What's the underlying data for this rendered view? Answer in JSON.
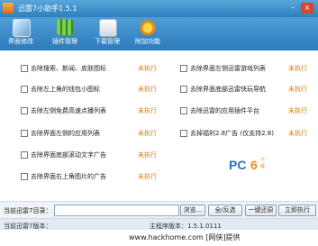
{
  "window": {
    "title": "迅雷7小助手1.5.1",
    "minimize_glyph": "–",
    "close_glyph": "×"
  },
  "toolbar": {
    "items": [
      {
        "label": "界面修改",
        "icon": "window-icon"
      },
      {
        "label": "插件管理",
        "icon": "plugin-bars-icon"
      },
      {
        "label": "下载管理",
        "icon": "download-icon"
      },
      {
        "label": "附加功能",
        "icon": "extra-features-icon"
      }
    ]
  },
  "options": {
    "left": [
      {
        "label": "去除搜索、新闻、皮肤图标",
        "status": "未执行"
      },
      {
        "label": "去除左上角的钱包小图标",
        "status": "未执行"
      },
      {
        "label": "去除左侧免费高速点播列表",
        "status": "未执行"
      },
      {
        "label": "去除界面左侧的应用列表",
        "status": "未执行"
      },
      {
        "label": "去除界面底部滚动文字广告",
        "status": "未执行"
      },
      {
        "label": "去除界面右上角图片的广告",
        "status": "未执行"
      }
    ],
    "right": [
      {
        "label": "去除界面左侧迅雷游戏列表",
        "status": "未执行"
      },
      {
        "label": "去除界面底部迅雷快玩导航",
        "status": "未执行"
      },
      {
        "label": "去除迅雷的应用插件平台",
        "status": "未执行"
      },
      {
        "label": "去掉福利2.8广告 (仅支持2.8)",
        "status": "未执行"
      }
    ]
  },
  "watermark": {
    "brand": "PC",
    "accent": "6",
    "small": "下载"
  },
  "bottom": {
    "dir_label": "当前迅雷7目录：",
    "dir_value": "",
    "buttons": {
      "browse": "浏览...",
      "select_all": "全/反选",
      "restore": "一键还原",
      "run": "立即执行"
    }
  },
  "status": {
    "version": "当前迅雷7版本：",
    "main_version": "主程序版本：1.5.1.0111"
  },
  "footer": {
    "text": "www.hackhome.com [网侠]提供"
  },
  "colors": {
    "titlebar": "#2f7fbf",
    "toolbar": "#3b8bcc",
    "status_pending": "#e07a00"
  }
}
